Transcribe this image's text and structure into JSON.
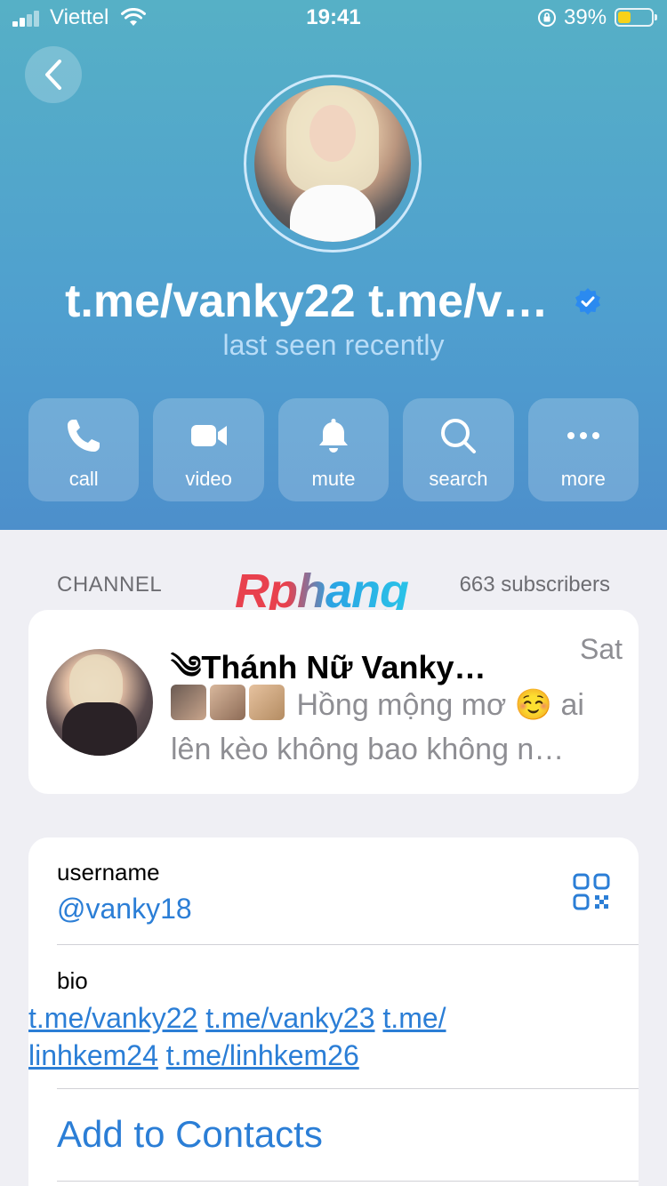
{
  "status_bar": {
    "carrier": "Viettel",
    "time": "19:41",
    "battery_percent": "39%",
    "battery_level": 0.39
  },
  "profile": {
    "name": "t.me/vanky22 t.me/v…",
    "status": "last seen recently"
  },
  "actions": [
    {
      "label": "call",
      "icon": "phone-icon"
    },
    {
      "label": "video",
      "icon": "video-camera-icon"
    },
    {
      "label": "mute",
      "icon": "bell-icon"
    },
    {
      "label": "search",
      "icon": "search-icon"
    },
    {
      "label": "more",
      "icon": "more-dots-icon"
    }
  ],
  "channel": {
    "section_label": "CHANNEL",
    "subscribers": "663 subscribers",
    "title": "༄Thánh Nữ Vanky…",
    "time": "Sat",
    "preview_line1": "Hồng mộng mơ ☺️ ai",
    "preview_line2": "lên kèo không bao không n…"
  },
  "watermark": "Rphang",
  "info": {
    "username_label": "username",
    "username_value": "@vanky18",
    "bio_label": "bio",
    "bio_links": [
      "t.me/vanky22",
      "t.me/vanky23",
      "t.me/",
      "linhkem24",
      "t.me/linhkem26"
    ],
    "add_contacts": "Add to Contacts"
  },
  "colors": {
    "accent": "#2b7ed6",
    "verified": "#2b8af0",
    "battery": "#f7d21a"
  }
}
